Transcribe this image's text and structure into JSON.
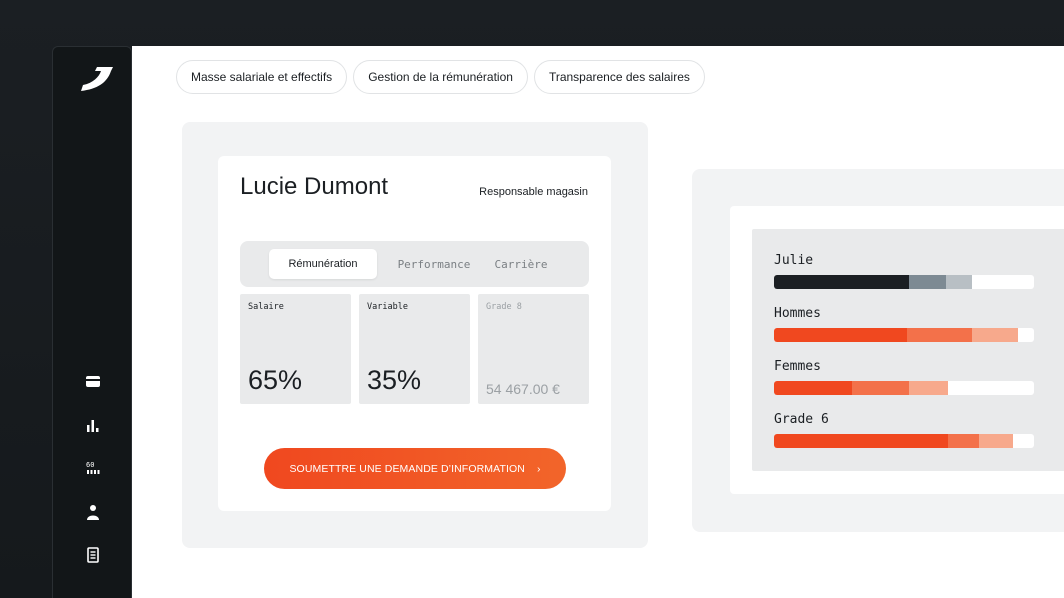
{
  "sidebar": {
    "logo": "brand-logo",
    "icons": [
      "wallet-icon",
      "bar-chart-icon",
      "calculator-icon",
      "user-icon",
      "document-icon"
    ]
  },
  "pills": [
    {
      "label": "Masse salariale et effectifs"
    },
    {
      "label": "Gestion de la rémunération"
    },
    {
      "label": "Transparence des salaires"
    }
  ],
  "employee": {
    "name": "Lucie Dumont",
    "role": "Responsable magasin"
  },
  "tabs": [
    {
      "label": "Rémunération",
      "active": true
    },
    {
      "label": "Performance",
      "active": false
    },
    {
      "label": "Carrière",
      "active": false
    }
  ],
  "metrics": [
    {
      "label": "Salaire",
      "value": "65%"
    },
    {
      "label": "Variable",
      "value": "35%"
    },
    {
      "label": "Grade 8",
      "value": "54 467.00 €"
    }
  ],
  "cta": {
    "label": "SOUMETTRE UNE DEMANDE D’INFORMATION",
    "arrow": "›"
  },
  "comparison": {
    "rows": [
      {
        "label": "Julie",
        "segments": [
          0.52,
          0.14,
          0.1
        ],
        "colors": [
          "#1b1f23",
          "#7d8a93",
          "#b8bfc4"
        ]
      },
      {
        "label": "Hommes",
        "segments": [
          0.51,
          0.25,
          0.18
        ],
        "colors": [
          "#f0481f",
          "#f3714a",
          "#f7a98c"
        ]
      },
      {
        "label": "Femmes",
        "segments": [
          0.3,
          0.22,
          0.15
        ],
        "colors": [
          "#f0481f",
          "#f3714a",
          "#f7a98c"
        ]
      },
      {
        "label": "Grade 6",
        "segments": [
          0.67,
          0.12,
          0.13
        ],
        "colors": [
          "#f0481f",
          "#f3714a",
          "#f7a98c"
        ]
      }
    ]
  },
  "colors": {
    "accent": "#f0481f",
    "dark": "#1b1f23"
  }
}
